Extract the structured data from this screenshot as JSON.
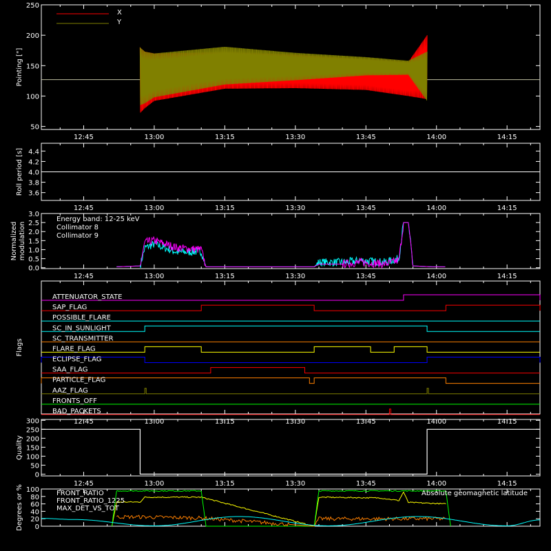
{
  "chart_data": [
    {
      "type": "line",
      "ylabel": "Pointing [\"]",
      "ylim": [
        45,
        250
      ],
      "yticks": [
        50,
        100,
        150,
        200,
        250
      ],
      "xticks": [
        "12:45",
        "13:00",
        "13:15",
        "13:30",
        "13:45",
        "14:00",
        "14:15"
      ],
      "legend_position": "top-left",
      "series": [
        {
          "name": "X",
          "color": "#ff0000",
          "x": [
            "12:57",
            "12:58",
            "13:00",
            "13:15",
            "13:30",
            "13:45",
            "13:54",
            "13:58"
          ],
          "low": [
            72,
            80,
            92,
            112,
            113,
            110,
            100,
            95
          ],
          "high": [
            180,
            173,
            170,
            172,
            168,
            160,
            156,
            200
          ]
        },
        {
          "name": "Y",
          "color": "#808000",
          "x": [
            "12:57",
            "12:58",
            "13:00",
            "13:15",
            "13:30",
            "13:45",
            "13:54",
            "13:58"
          ],
          "low": [
            85,
            88,
            98,
            119,
            126,
            134,
            135,
            92
          ],
          "high": [
            180,
            173,
            170,
            181,
            171,
            164,
            158,
            173
          ]
        }
      ],
      "baseline": 127
    },
    {
      "type": "line",
      "ylabel": "Roll period [s]",
      "ylim": [
        3.45,
        4.55
      ],
      "yticks": [
        "3.6",
        "3.8",
        "4.0",
        "4.2",
        "4.4"
      ],
      "xticks": [
        "12:45",
        "13:00",
        "13:15",
        "13:30",
        "13:45",
        "14:00",
        "14:15"
      ],
      "series": [
        {
          "color": "#ffffff",
          "x": [
            "12:36",
            "14:22"
          ],
          "y": [
            4.0,
            4.0
          ]
        }
      ]
    },
    {
      "type": "line",
      "ylabel": "Normalized modulation",
      "ylim": [
        -0.05,
        3.0
      ],
      "yticks": [
        "0.0",
        "0.5",
        "1.0",
        "1.5",
        "2.0",
        "2.5",
        "3.0"
      ],
      "xticks": [
        "12:45",
        "13:00",
        "13:15",
        "13:30",
        "13:45",
        "14:00",
        "14:15"
      ],
      "annotation": "Energy band: 12-25 keV",
      "legend_position": "top-left",
      "series": [
        {
          "name": "Collimator 8",
          "color": "#00ffff",
          "x": [
            "12:52",
            "12:57",
            "12:58",
            "13:00",
            "13:05",
            "13:10",
            "13:11",
            "13:34",
            "13:35",
            "13:40",
            "13:44",
            "13:49",
            "13:52",
            "13:53",
            "13:54",
            "13:55",
            "13:59",
            "14:02"
          ],
          "y": [
            0.05,
            0.1,
            1.1,
            1.3,
            0.85,
            0.9,
            0.05,
            0.05,
            0.3,
            0.3,
            0.4,
            0.3,
            0.5,
            2.5,
            2.5,
            0.1,
            0.05,
            0.05
          ]
        },
        {
          "name": "Collimator 9",
          "color": "#ff00ff",
          "x": [
            "12:52",
            "12:57",
            "12:58",
            "13:00",
            "13:05",
            "13:10",
            "13:11",
            "13:34",
            "13:35",
            "13:40",
            "13:44",
            "13:49",
            "13:52",
            "13:53",
            "13:54",
            "13:55",
            "13:59",
            "14:02"
          ],
          "y": [
            0.05,
            0.1,
            1.4,
            1.5,
            1.1,
            1.0,
            0.05,
            0.05,
            0.2,
            0.2,
            0.3,
            0.2,
            0.4,
            2.5,
            2.5,
            0.1,
            0.05,
            0.05
          ]
        }
      ]
    },
    {
      "type": "line",
      "ylabel": "Flags",
      "xticks": [
        "12:45",
        "13:00",
        "13:15",
        "13:30",
        "13:45",
        "14:00",
        "14:15"
      ],
      "flags": [
        {
          "name": "ATTENUATOR_STATE",
          "color": "#ff00ff",
          "on": [
            [
              "13:53",
              "14:22"
            ]
          ]
        },
        {
          "name": "SAP_FLAG",
          "color": "#ff0000",
          "on": [
            [
              "13:10",
              "13:34"
            ],
            [
              "14:02",
              "14:22"
            ]
          ]
        },
        {
          "name": "POSSIBLE_FLARE",
          "color": "#00ffff",
          "on": []
        },
        {
          "name": "SC_IN_SUNLIGHT",
          "color": "#00ffff",
          "on": [
            [
              "12:58",
              "13:58"
            ]
          ]
        },
        {
          "name": "SC_TRANSMITTER",
          "color": "#ff8000",
          "on": []
        },
        {
          "name": "FLARE_FLAG",
          "color": "#ffff00",
          "on": [
            [
              "12:58",
              "13:10"
            ],
            [
              "13:34",
              "13:46"
            ],
            [
              "13:51",
              "13:58"
            ]
          ]
        },
        {
          "name": "ECLIPSE_FLAG",
          "color": "#0000ff",
          "on": [
            [
              "12:36",
              "12:58"
            ],
            [
              "13:58",
              "14:22"
            ]
          ]
        },
        {
          "name": "SAA_FLAG",
          "color": "#ff0000",
          "on": [
            [
              "13:12",
              "13:32"
            ]
          ]
        },
        {
          "name": "PARTICLE_FLAG",
          "color": "#ff8000",
          "on": [
            [
              "12:36",
              "13:33"
            ],
            [
              "13:34",
              "14:02"
            ]
          ]
        },
        {
          "name": "AAZ_FLAG",
          "color": "#808000",
          "on": [
            [
              "12:58",
              "12:58"
            ],
            [
              "13:58",
              "13:58"
            ]
          ]
        },
        {
          "name": "FRONTS_OFF",
          "color": "#00ff00",
          "on": []
        },
        {
          "name": "BAD_PACKETS",
          "color": "#ff0000",
          "on": [
            [
              "13:50",
              "13:50"
            ]
          ]
        }
      ]
    },
    {
      "type": "line",
      "ylabel": "Quality",
      "ylim": [
        -10,
        305
      ],
      "yticks": [
        0,
        50,
        100,
        150,
        200,
        250,
        300
      ],
      "xticks": [
        "12:45",
        "13:00",
        "13:15",
        "13:30",
        "13:45",
        "14:00",
        "14:15"
      ],
      "series": [
        {
          "color": "#ffffff",
          "x": [
            "12:36",
            "12:57",
            "12:57",
            "13:58",
            "13:58",
            "14:22"
          ],
          "y": [
            250,
            250,
            0,
            0,
            250,
            250
          ]
        }
      ]
    },
    {
      "type": "line",
      "ylabel": "Degrees or %",
      "ylim": [
        0,
        100
      ],
      "yticks": [
        0,
        20,
        40,
        60,
        80,
        100
      ],
      "legend_position": "top-left",
      "series": [
        {
          "name": "FRONT_RATIO",
          "color": "#ffff00",
          "x": [
            "12:51",
            "12:52",
            "12:57",
            "12:58",
            "13:10",
            "13:34",
            "13:35",
            "13:48",
            "13:52",
            "13:53",
            "13:54",
            "14:02"
          ],
          "y": [
            0,
            65,
            65,
            78,
            78,
            0,
            78,
            76,
            69,
            92,
            64,
            60
          ]
        },
        {
          "name": "FRONT_RATIO_1225",
          "color": "#00ff00",
          "x": [
            "12:51",
            "12:52",
            "13:10",
            "13:11",
            "13:34",
            "13:35",
            "14:02",
            "14:03"
          ],
          "y": [
            0,
            95,
            95,
            0,
            0,
            95,
            95,
            0
          ]
        },
        {
          "name": "MAX_DET_VS_TOT",
          "color": "#ff8000",
          "x": [
            "12:52",
            "12:57",
            "13:10",
            "13:34",
            "13:35",
            "13:45",
            "14:02"
          ],
          "y": [
            25,
            25,
            22,
            0,
            20,
            20,
            20
          ]
        },
        {
          "name": "Absolute geomagnetic latitude",
          "color": "#00ffff",
          "x": [
            "12:36",
            "12:43",
            "13:00",
            "13:18",
            "13:37",
            "13:56",
            "14:15",
            "14:22"
          ],
          "y": [
            21,
            18,
            1,
            26,
            1,
            26,
            1,
            17
          ]
        }
      ]
    }
  ]
}
